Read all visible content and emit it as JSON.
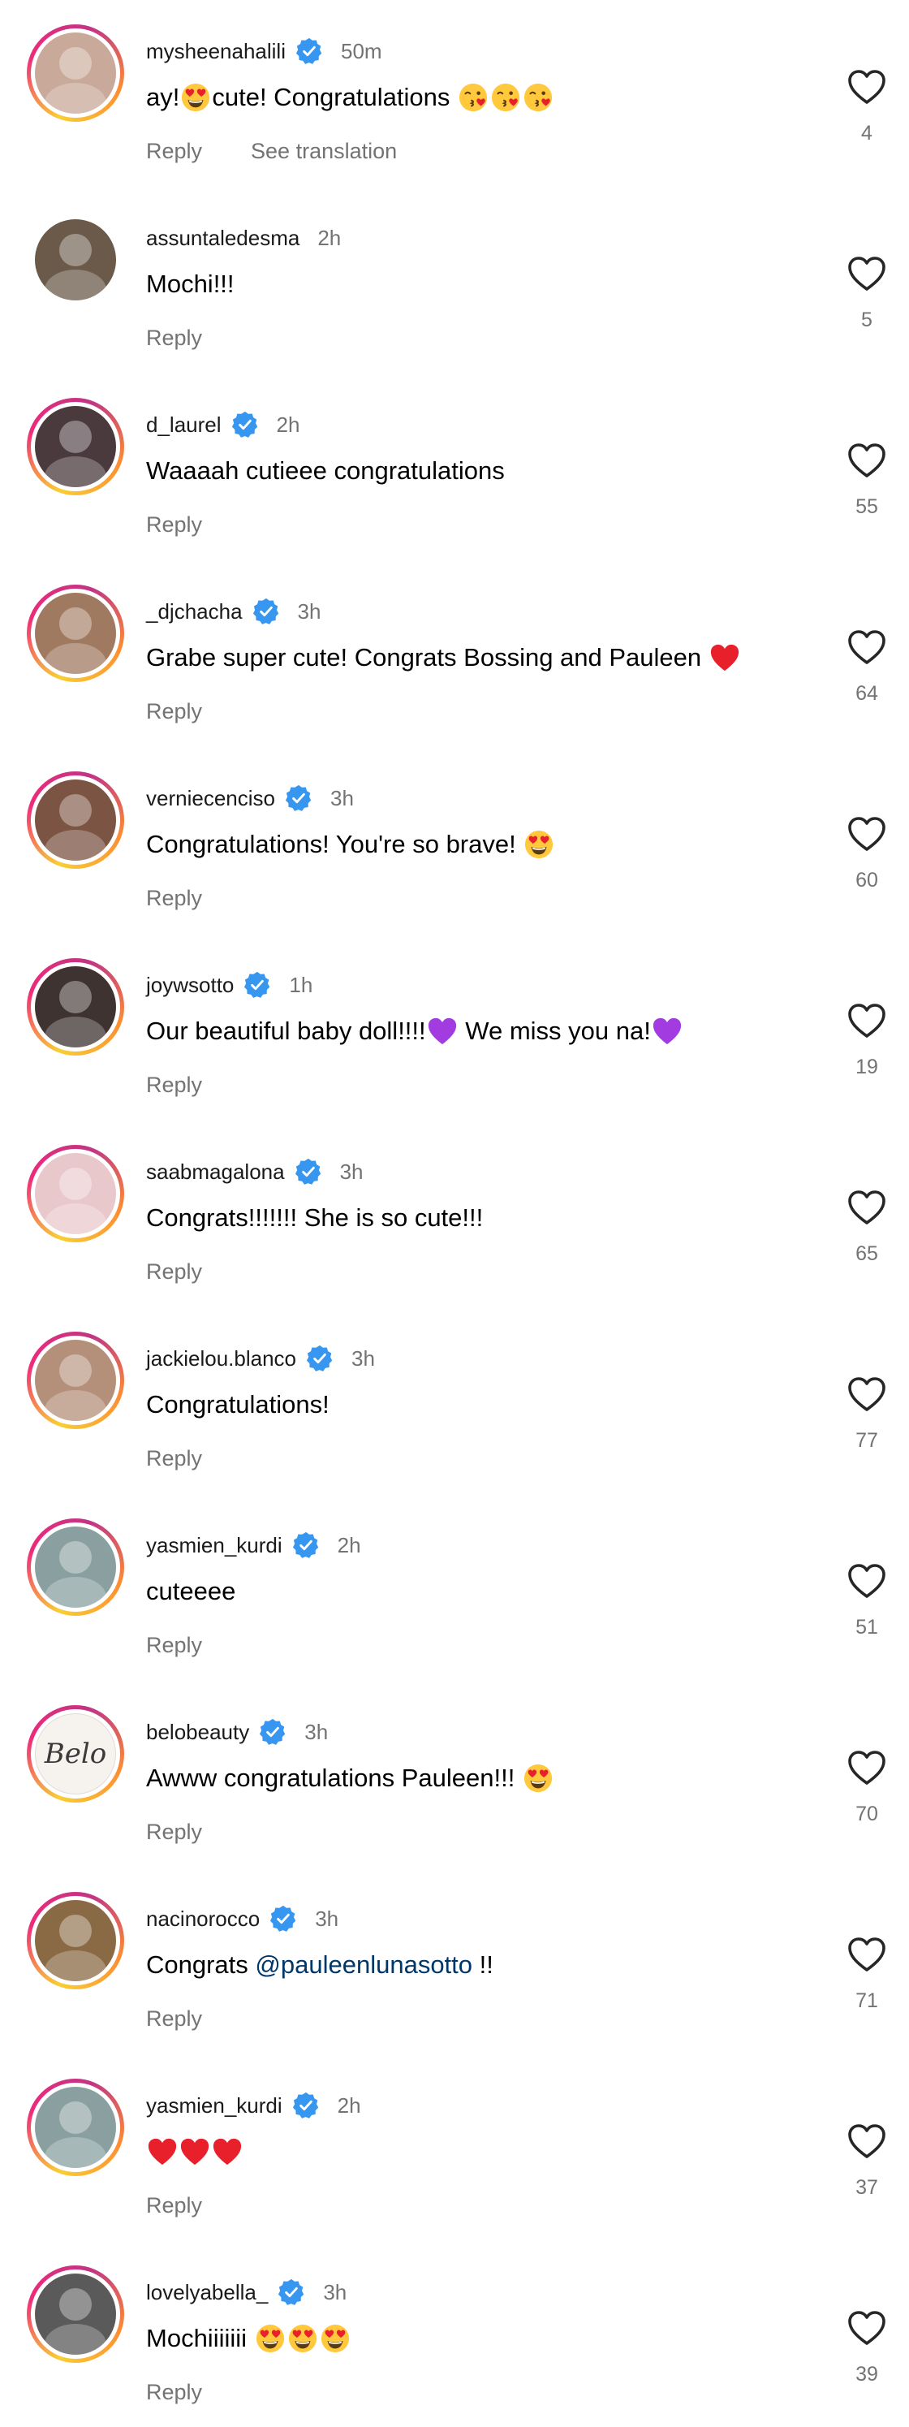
{
  "colors": {
    "verified": "#3797f0",
    "muted": "#737373",
    "mention": "#00376b",
    "story_ring": [
      "#f9ce34",
      "#ee2a7b",
      "#c13584"
    ]
  },
  "comments": [
    {
      "username": "mysheenahalili",
      "verified": true,
      "time": "50m",
      "text_parts": [
        {
          "type": "text",
          "value": "ay!"
        },
        {
          "type": "emoji",
          "name": "heart-eyes"
        },
        {
          "type": "text",
          "value": "cute! Congratulations "
        },
        {
          "type": "emoji",
          "name": "kiss"
        },
        {
          "type": "emoji",
          "name": "kiss"
        },
        {
          "type": "emoji",
          "name": "kiss"
        }
      ],
      "reply_label": "Reply",
      "translation_label": "See translation",
      "likes": "4",
      "avatar_icon": "avatar-photo",
      "avatar_color": "#c9a99a",
      "ring": true
    },
    {
      "username": "assuntaledesma",
      "verified": false,
      "time": "2h",
      "text_parts": [
        {
          "type": "text",
          "value": "Mochi!!!"
        }
      ],
      "reply_label": "Reply",
      "likes": "5",
      "avatar_icon": "avatar-photo",
      "avatar_color": "#6b5a4a",
      "ring": false
    },
    {
      "username": "d_laurel",
      "verified": true,
      "time": "2h",
      "text_parts": [
        {
          "type": "text",
          "value": "Waaaah cutieee congratulations"
        }
      ],
      "reply_label": "Reply",
      "likes": "55",
      "avatar_icon": "avatar-photo",
      "avatar_color": "#4a3a3e",
      "ring": true
    },
    {
      "username": "_djchacha",
      "verified": true,
      "time": "3h",
      "text_parts": [
        {
          "type": "text",
          "value": "Grabe super cute! Congrats Bossing and Pauleen "
        },
        {
          "type": "emoji",
          "name": "red-heart"
        }
      ],
      "reply_label": "Reply",
      "likes": "64",
      "avatar_icon": "avatar-photo",
      "avatar_color": "#a07a60",
      "ring": true
    },
    {
      "username": "verniecenciso",
      "verified": true,
      "time": "3h",
      "text_parts": [
        {
          "type": "text",
          "value": "Congratulations! You're so brave! "
        },
        {
          "type": "emoji",
          "name": "heart-eyes"
        }
      ],
      "reply_label": "Reply",
      "likes": "60",
      "avatar_icon": "avatar-photo",
      "avatar_color": "#7b5443",
      "ring": true
    },
    {
      "username": "joywsotto",
      "verified": true,
      "time": "1h",
      "text_parts": [
        {
          "type": "text",
          "value": "Our beautiful baby doll!!!!"
        },
        {
          "type": "emoji",
          "name": "purple-heart"
        },
        {
          "type": "text",
          "value": " We miss you na!"
        },
        {
          "type": "emoji",
          "name": "purple-heart"
        }
      ],
      "reply_label": "Reply",
      "likes": "19",
      "avatar_icon": "avatar-photo",
      "avatar_color": "#3e3330",
      "ring": true
    },
    {
      "username": "saabmagalona",
      "verified": true,
      "time": "3h",
      "text_parts": [
        {
          "type": "text",
          "value": "Congrats!!!!!!! She is so cute!!!"
        }
      ],
      "reply_label": "Reply",
      "likes": "65",
      "avatar_icon": "avatar-photo",
      "avatar_color": "#e9c8cc",
      "ring": true
    },
    {
      "username": "jackielou.blanco",
      "verified": true,
      "time": "3h",
      "text_parts": [
        {
          "type": "text",
          "value": "Congratulations!"
        }
      ],
      "reply_label": "Reply",
      "likes": "77",
      "avatar_icon": "avatar-photo",
      "avatar_color": "#b48f7a",
      "ring": true
    },
    {
      "username": "yasmien_kurdi",
      "verified": true,
      "time": "2h",
      "text_parts": [
        {
          "type": "text",
          "value": "cuteeee"
        }
      ],
      "reply_label": "Reply",
      "likes": "51",
      "avatar_icon": "avatar-photo",
      "avatar_color": "#8aa0a0",
      "ring": true
    },
    {
      "username": "belobeauty",
      "verified": true,
      "time": "3h",
      "text_parts": [
        {
          "type": "text",
          "value": "Awww congratulations Pauleen!!! "
        },
        {
          "type": "emoji",
          "name": "heart-eyes"
        }
      ],
      "reply_label": "Reply",
      "likes": "70",
      "avatar_icon": "avatar-logo",
      "avatar_logo_text": "Belo",
      "avatar_color": "#f6f2ee",
      "ring": true
    },
    {
      "username": "nacinorocco",
      "verified": true,
      "time": "3h",
      "text_parts": [
        {
          "type": "text",
          "value": "Congrats "
        },
        {
          "type": "mention",
          "value": "@pauleenlunasotto"
        },
        {
          "type": "text",
          "value": " !!"
        }
      ],
      "reply_label": "Reply",
      "likes": "71",
      "avatar_icon": "avatar-photo",
      "avatar_color": "#8a6a45",
      "ring": true
    },
    {
      "username": "yasmien_kurdi",
      "verified": true,
      "time": "2h",
      "text_parts": [
        {
          "type": "emoji",
          "name": "red-heart"
        },
        {
          "type": "emoji",
          "name": "red-heart"
        },
        {
          "type": "emoji",
          "name": "red-heart"
        }
      ],
      "reply_label": "Reply",
      "likes": "37",
      "avatar_icon": "avatar-photo",
      "avatar_color": "#8aa0a0",
      "ring": true
    },
    {
      "username": "lovelyabella_",
      "verified": true,
      "time": "3h",
      "text_parts": [
        {
          "type": "text",
          "value": "Mochiiiiiii "
        },
        {
          "type": "emoji",
          "name": "heart-eyes"
        },
        {
          "type": "emoji",
          "name": "heart-eyes"
        },
        {
          "type": "emoji",
          "name": "heart-eyes"
        }
      ],
      "reply_label": "Reply",
      "likes": "39",
      "avatar_icon": "avatar-photo",
      "avatar_color": "#5a5a5a",
      "ring": true
    }
  ]
}
